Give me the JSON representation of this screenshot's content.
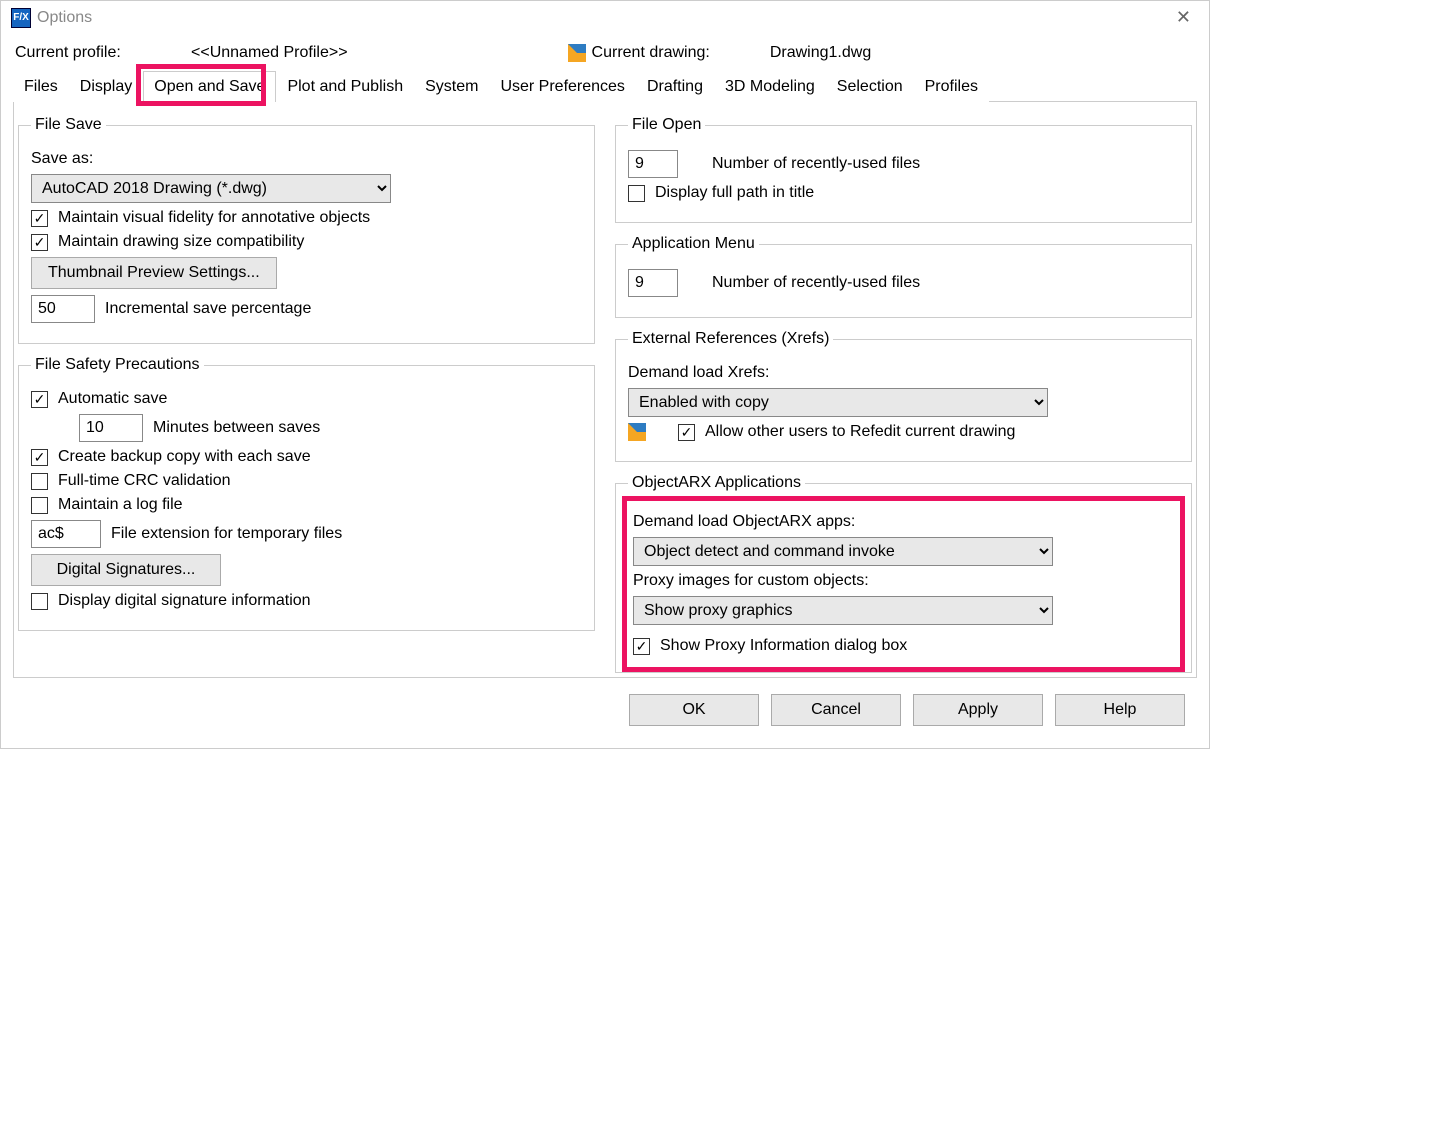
{
  "title": "Options",
  "profile": {
    "label": "Current profile:",
    "value": "<<Unnamed Profile>>",
    "drawing_label": "Current drawing:",
    "drawing_value": "Drawing1.dwg"
  },
  "tabs": [
    "Files",
    "Display",
    "Open and Save",
    "Plot and Publish",
    "System",
    "User Preferences",
    "Drafting",
    "3D Modeling",
    "Selection",
    "Profiles"
  ],
  "active_tab_index": 2,
  "file_save": {
    "legend": "File Save",
    "save_as_label": "Save as:",
    "save_as_value": "AutoCAD 2018 Drawing (*.dwg)",
    "maintain_fidelity": "Maintain visual fidelity for annotative objects",
    "maintain_size": "Maintain drawing size compatibility",
    "thumb_btn": "Thumbnail Preview Settings...",
    "inc_val": "50",
    "inc_lbl": "Incremental save percentage"
  },
  "file_safety": {
    "legend": "File Safety Precautions",
    "auto_save": "Automatic save",
    "minutes_val": "10",
    "minutes_lbl": "Minutes between saves",
    "backup": "Create backup copy with each save",
    "crc": "Full-time CRC validation",
    "logfile": "Maintain a log file",
    "ext_val": "ac$",
    "ext_lbl": "File extension for temporary files",
    "digsig_btn": "Digital Signatures...",
    "digsig_display": "Display digital signature information"
  },
  "file_open": {
    "legend": "File Open",
    "recent_val": "9",
    "recent_lbl": "Number of recently-used files",
    "fullpath": "Display full path in title"
  },
  "app_menu": {
    "legend": "Application Menu",
    "recent_val": "9",
    "recent_lbl": "Number of recently-used files"
  },
  "xrefs": {
    "legend": "External References (Xrefs)",
    "demand_lbl": "Demand load Xrefs:",
    "demand_val": "Enabled with copy",
    "allow_refedit": "Allow other users to Refedit current drawing"
  },
  "arx": {
    "legend": "ObjectARX Applications",
    "demand_lbl": "Demand load ObjectARX apps:",
    "demand_val": "Object detect and command invoke",
    "proxy_lbl": "Proxy images for custom objects:",
    "proxy_val": "Show proxy graphics",
    "show_proxy_info": "Show Proxy Information dialog box"
  },
  "footer": {
    "ok": "OK",
    "cancel": "Cancel",
    "apply": "Apply",
    "help": "Help"
  }
}
